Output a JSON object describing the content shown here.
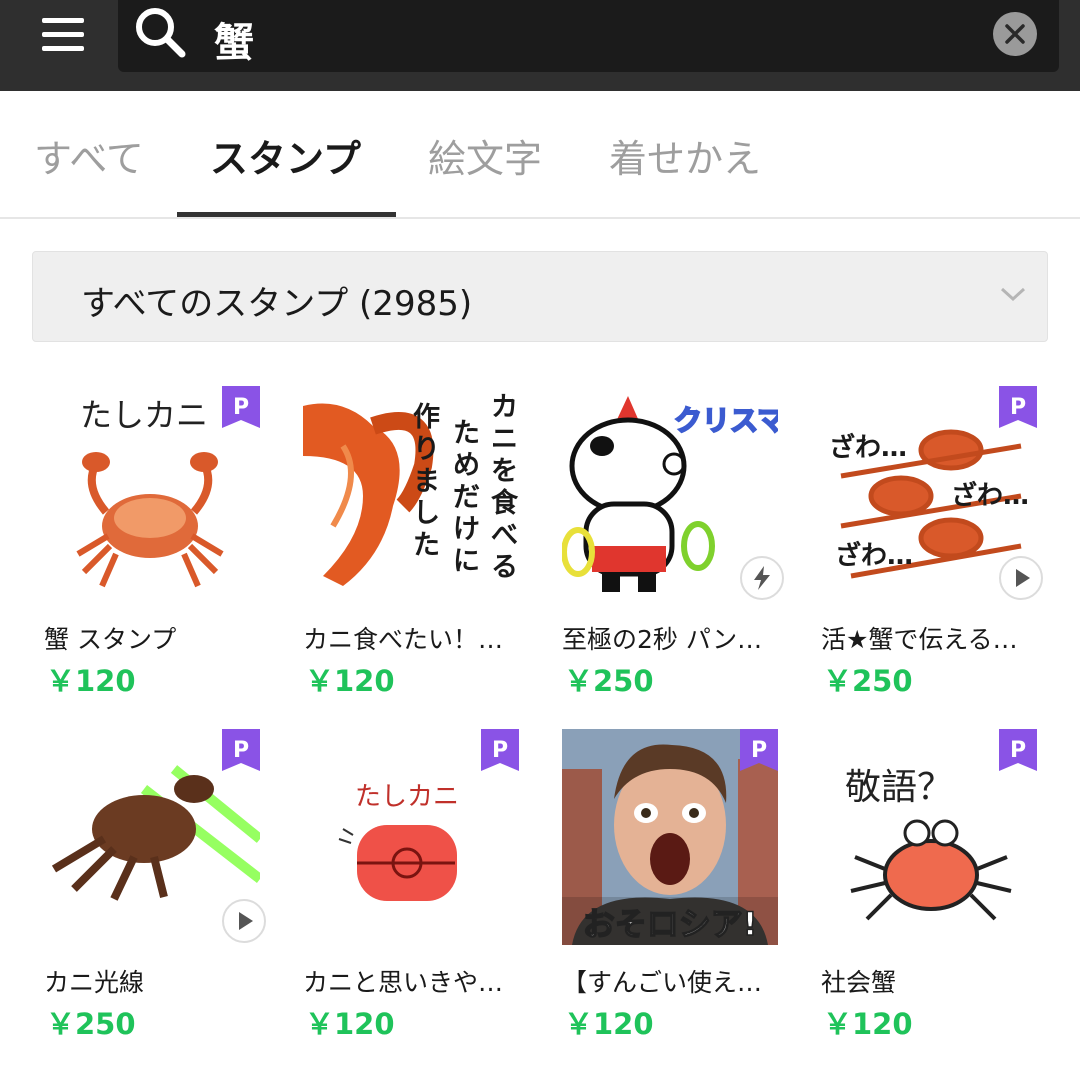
{
  "search": {
    "query": "蟹"
  },
  "tabs": [
    {
      "label": "すべて",
      "active": false
    },
    {
      "label": "スタンプ",
      "active": true
    },
    {
      "label": "絵文字",
      "active": false
    },
    {
      "label": "着せかえ",
      "active": false
    }
  ],
  "filter": {
    "label": "すべてのスタンプ (2985)"
  },
  "colors": {
    "price": "#1fc35a",
    "premium_badge": "#8a53e6",
    "topbar": "#2f2f2f"
  },
  "items": [
    {
      "title": "蟹 スタンプ",
      "price": "￥120",
      "premium": true,
      "overlay": "",
      "image_text": "たしカニ"
    },
    {
      "title": "カニ食べたい！…",
      "price": "￥120",
      "premium": false,
      "overlay": "",
      "image_text": "カニを食べるためだけに作りました"
    },
    {
      "title": "至極の2秒 パン…",
      "price": "￥250",
      "premium": false,
      "overlay": "bolt-icon",
      "image_text": "クリスマス?"
    },
    {
      "title": "活★蟹で伝える…",
      "price": "￥250",
      "premium": true,
      "overlay": "play-icon",
      "image_text": "ざわ…"
    },
    {
      "title": "カニ光線",
      "price": "￥250",
      "premium": true,
      "overlay": "play-icon",
      "image_text": ""
    },
    {
      "title": "カニと思いきや…",
      "price": "￥120",
      "premium": true,
      "overlay": "",
      "image_text": "たしカニ"
    },
    {
      "title": "【すんごい使え…",
      "price": "￥120",
      "premium": true,
      "overlay": "",
      "image_text": "おそロシア!"
    },
    {
      "title": "社会蟹",
      "price": "￥120",
      "premium": true,
      "overlay": "",
      "image_text": "敬語？"
    }
  ]
}
